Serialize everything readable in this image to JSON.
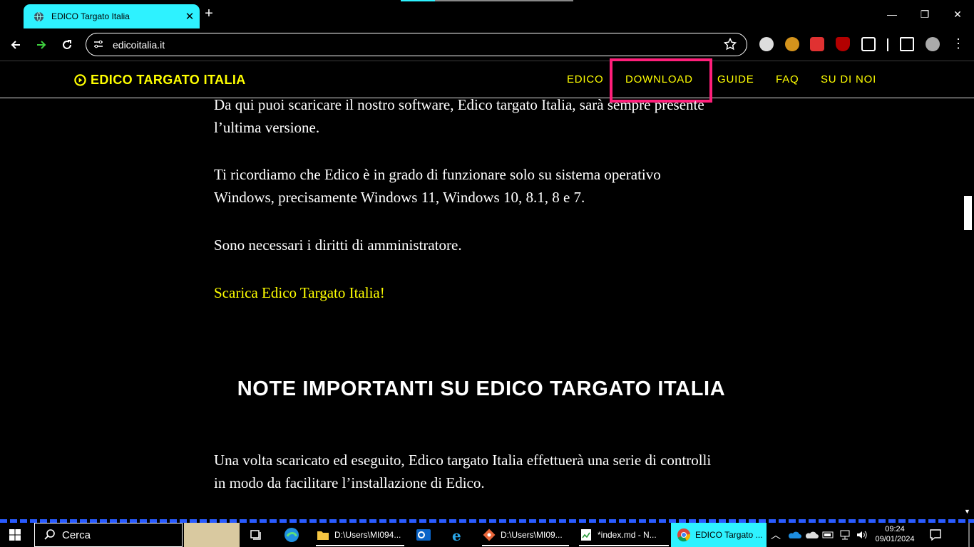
{
  "browser": {
    "tab_title": "EDICO Targato Italia",
    "url": "edicoitalia.it"
  },
  "site": {
    "brand": "EDICO TARGATO ITALIA",
    "nav": [
      "EDICO",
      "DOWNLOAD",
      "GUIDE",
      "FAQ",
      "SU DI NOI"
    ],
    "highlighted_nav": "DOWNLOAD",
    "accent_color": "#ffff00",
    "highlight_color": "#ff1f7a",
    "paragraphs": [
      "Da qui puoi scaricare il nostro software, Edico targato Italia, sarà sempre presente l’ultima versione.",
      "Ti ricordiamo che Edico è in grado di funzionare solo su sistema operativo Windows, precisamente Windows 11, Windows 10, 8.1, 8 e 7.",
      "Sono necessari i diritti di amministratore."
    ],
    "download_link": "Scarica Edico Targato Italia!",
    "section_heading": "NOTE IMPORTANTI SU EDICO TARGATO ITALIA",
    "section_paragraph": "Una volta scaricato ed eseguito, Edico targato Italia effettuerà una serie di controlli in modo da facilitare l’installazione di Edico."
  },
  "taskbar": {
    "search_placeholder": "Cerca",
    "apps": [
      {
        "label": "D:\\Users\\MI094...",
        "icon": "folder-icon"
      },
      {
        "label": "D:\\Users\\MI09...",
        "icon": "git-icon"
      },
      {
        "label": "*index.md - N...",
        "icon": "notepad-icon"
      },
      {
        "label": "EDICO Targato ...",
        "icon": "chrome-icon"
      }
    ],
    "time": "09:24",
    "date": "09/01/2024"
  }
}
